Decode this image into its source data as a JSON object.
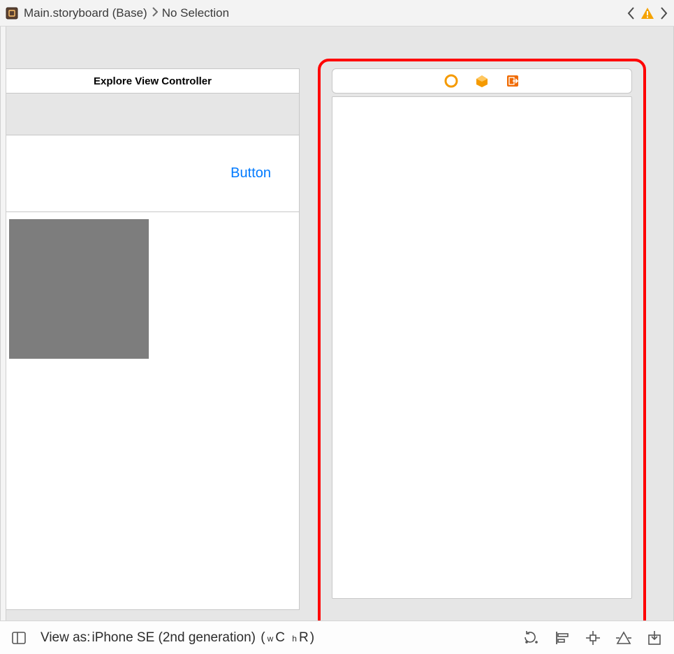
{
  "breadcrumb": {
    "file_name": "Main.storyboard (Base)",
    "selection_label": "No Selection"
  },
  "scenes": {
    "left": {
      "title": "Explore View Controller",
      "button_label": "Button"
    },
    "right": {
      "highlighted": true
    }
  },
  "bottom_bar": {
    "view_as_prefix": "View as: ",
    "device": "iPhone SE (2nd generation)",
    "width_class_label": "w",
    "width_class_value": "C",
    "height_class_label": "h",
    "height_class_value": "R"
  }
}
